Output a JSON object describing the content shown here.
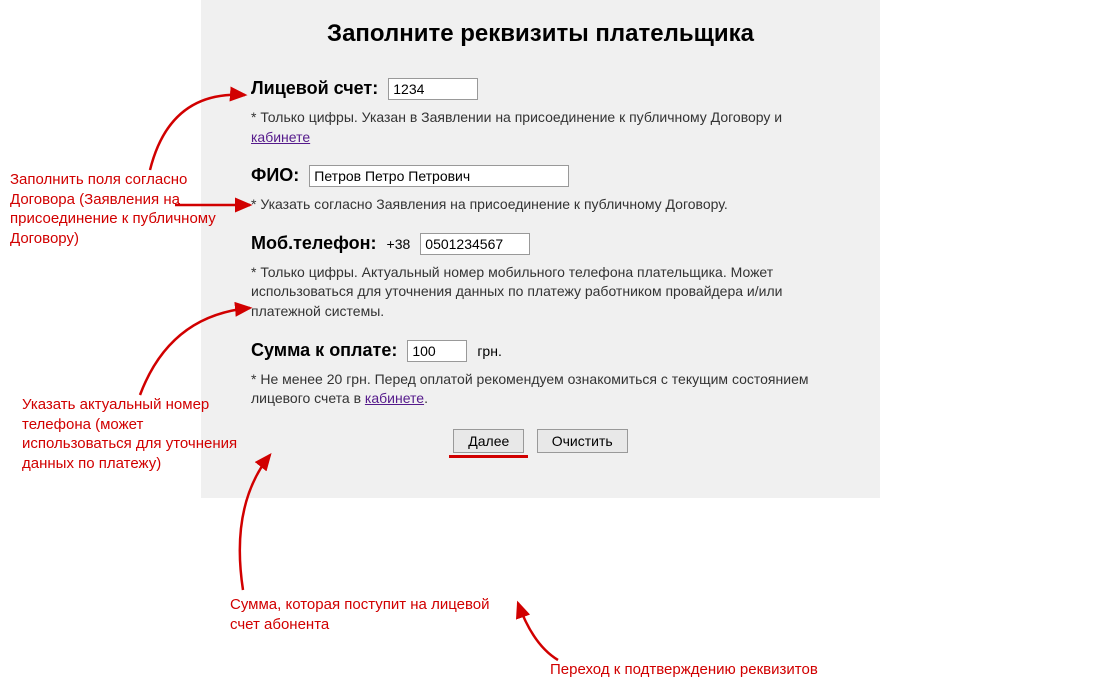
{
  "title": "Заполните реквизиты плательщика",
  "fields": {
    "account": {
      "label": "Лицевой счет:",
      "value": "1234",
      "hint_before": "* Только цифры. Указан в Заявлении на присоединение к публичному Договору и ",
      "hint_link": "кабинете"
    },
    "fio": {
      "label": "ФИО:",
      "value": "Петров Петро Петрович",
      "hint": "* Указать согласно Заявления на присоединение к публичному Договору."
    },
    "phone": {
      "label": "Моб.телефон:",
      "prefix": "+38",
      "value": "0501234567",
      "hint": "* Только цифры. Актуальный номер мобильного телефона плательщика. Может использоваться для уточнения данных по платежу работником провайдера и/или платежной системы."
    },
    "amount": {
      "label": "Сумма к оплате:",
      "value": "100",
      "unit": "грн.",
      "hint_before": "* Не менее 20 грн. Перед оплатой рекомендуем ознакомиться с текущим состоянием лицевого счета в ",
      "hint_link": "кабинете",
      "hint_after": "."
    }
  },
  "buttons": {
    "next": "Далее",
    "clear": "Очистить"
  },
  "annotations": {
    "a1": "Заполнить поля согласно Договора (Заявления на присоединение к публичному Договору)",
    "a2": "Указать актуальный номер телефона (может использоваться для уточнения данных по платежу)",
    "a3": "Сумма, которая поступит на лицевой счет абонента",
    "a4": "Переход к подтверждению реквизитов"
  }
}
